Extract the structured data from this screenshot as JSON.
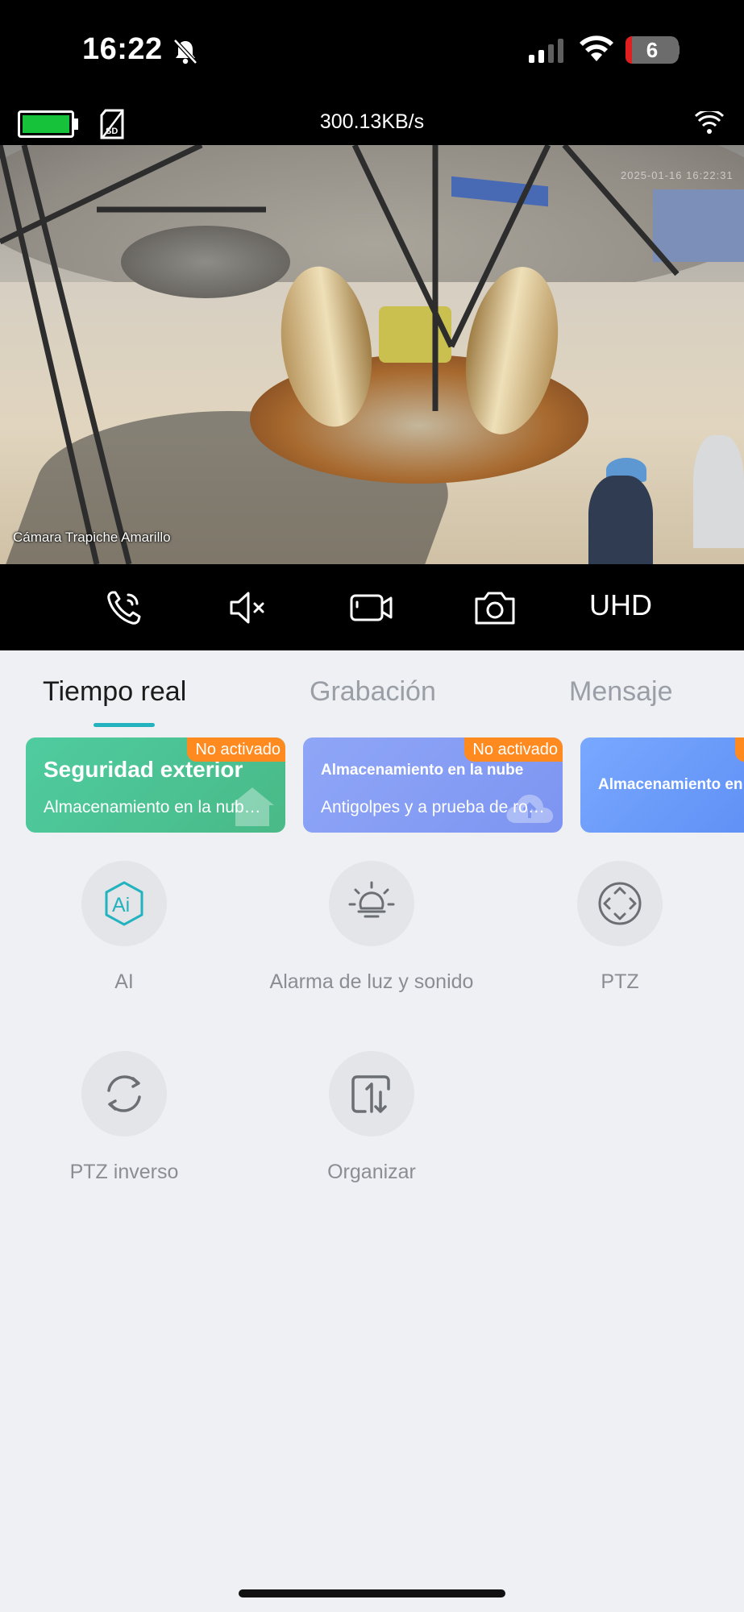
{
  "status_bar": {
    "time": "16:22",
    "battery_level": "6",
    "icons": [
      "bell-slash-icon",
      "cellular-signal-icon",
      "wifi-icon",
      "battery-icon"
    ]
  },
  "camera_info": {
    "speed": "300.13KB/s",
    "icons": [
      "device-battery-icon",
      "sd-card-icon",
      "device-wifi-icon"
    ]
  },
  "video": {
    "camera_label": "Cámara Trapiche Amarillo",
    "timestamp_overlay": "2025-01-16 16:22:31"
  },
  "controls": {
    "items": [
      {
        "name": "call-icon"
      },
      {
        "name": "mute-icon"
      },
      {
        "name": "record-video-icon"
      },
      {
        "name": "snapshot-camera-icon"
      }
    ],
    "quality_label": "UHD"
  },
  "tabs": [
    {
      "label": "Tiempo real",
      "active": true
    },
    {
      "label": "Grabación",
      "active": false
    },
    {
      "label": "Mensaje",
      "active": false
    }
  ],
  "cards": [
    {
      "badge": "No activado",
      "title": "Seguridad exterior",
      "subtitle": "Almacenamiento en la nube gratis"
    },
    {
      "badge": "No activado",
      "title": "Almacenamiento en la nube",
      "subtitle": "Antigolpes y a prueba de robos"
    },
    {
      "badge": "N",
      "title": "Almacenamiento en la nube"
    }
  ],
  "functions": [
    {
      "label": "AI",
      "icon": "ai-icon"
    },
    {
      "label": "Alarma de luz y sonido",
      "icon": "lightbulb-icon"
    },
    {
      "label": "PTZ",
      "icon": "ptz-icon"
    },
    {
      "label": "PTZ inverso",
      "icon": "ptz-reverse-icon"
    },
    {
      "label": "Organizar",
      "icon": "organize-icon"
    }
  ],
  "colors": {
    "accent": "#23b3bf",
    "badge": "#ff8a1f",
    "card_green": "#4fcca0",
    "card_purple": "#8fa6f7",
    "card_blue": "#78a8ff"
  }
}
